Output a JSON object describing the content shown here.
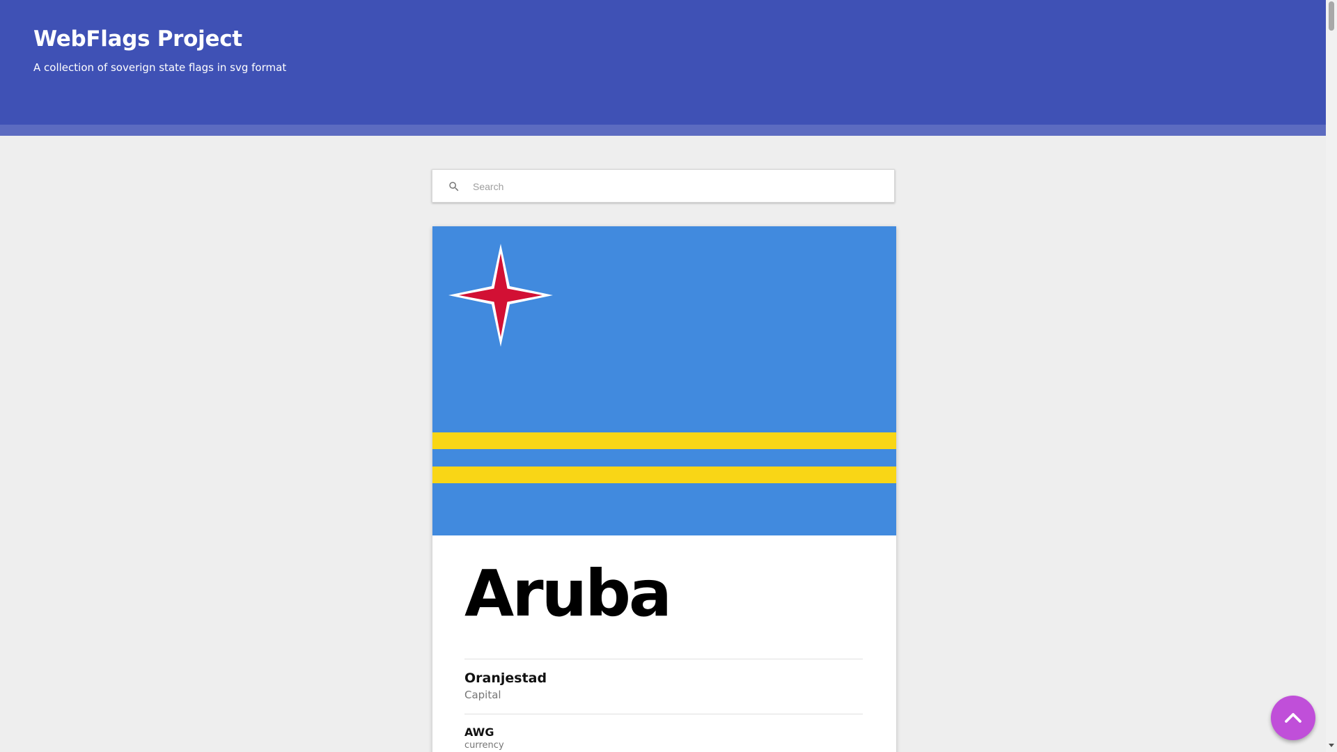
{
  "header": {
    "title": "WebFlags Project",
    "subtitle": "A collection of soverign state flags in svg format"
  },
  "search": {
    "placeholder": "Search",
    "value": "",
    "icon": "search-icon"
  },
  "country": {
    "name": "Aruba",
    "flag": {
      "background_color": "#418ade",
      "stripe_color": "#f9d616",
      "star_fill_color": "#d21034",
      "star_outline_color": "#ffffff"
    },
    "details": [
      {
        "value": "Oranjestad",
        "label": "Capital"
      },
      {
        "value": "AWG",
        "label": "currency"
      }
    ]
  },
  "scroll_top_button": {
    "icon": "chevron-up-icon",
    "color": "#c04fd9"
  },
  "colors": {
    "header": "#3f51b5",
    "header_strip": "#5c6bc0",
    "page_background": "#eeeeee"
  }
}
